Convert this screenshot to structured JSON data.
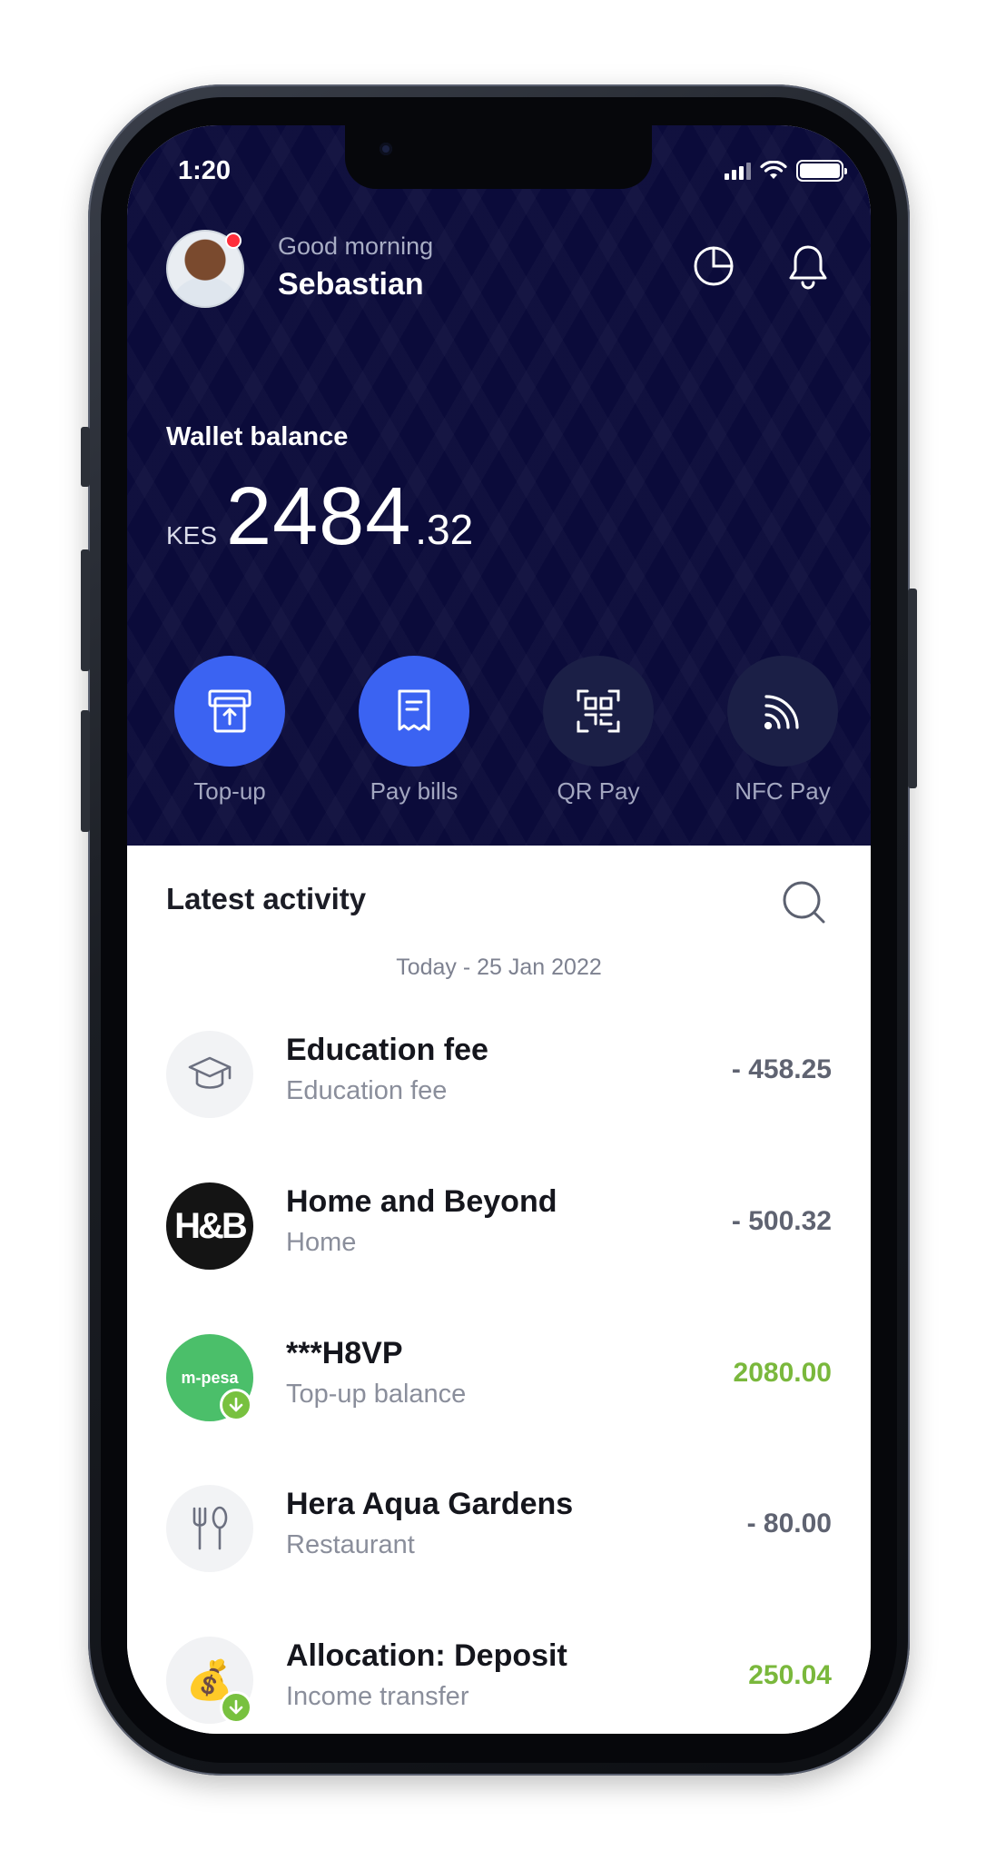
{
  "status": {
    "time": "1:20"
  },
  "user": {
    "greeting": "Good morning",
    "name": "Sebastian"
  },
  "wallet": {
    "label": "Wallet balance",
    "currency": "KES",
    "whole": "2484",
    "decimal": ".32"
  },
  "actions": [
    {
      "label": "Top-up",
      "icon": "top-up-icon"
    },
    {
      "label": "Pay bills",
      "icon": "receipt-icon"
    },
    {
      "label": "QR Pay",
      "icon": "qr-scan-icon"
    },
    {
      "label": "NFC Pay",
      "icon": "nfc-icon"
    }
  ],
  "activity": {
    "title": "Latest activity",
    "date": "Today - 25 Jan 2022",
    "transactions": [
      {
        "name": "Education fee",
        "sub": "Education fee",
        "amount": "- 458.25",
        "icon": "graduation-cap-icon"
      },
      {
        "name": "Home and Beyond",
        "sub": "Home",
        "amount": "- 500.32",
        "logo": "H&B"
      },
      {
        "name": "***H8VP",
        "sub": "Top-up balance",
        "amount": "2080.00",
        "logo": "m-pesa"
      },
      {
        "name": "Hera Aqua Gardens",
        "sub": "Restaurant",
        "amount": "- 80.00",
        "icon": "fork-knife-icon"
      },
      {
        "name": "Allocation: Deposit",
        "sub": "Income transfer",
        "amount": "250.04",
        "icon": "money-bag-icon"
      }
    ]
  },
  "colors": {
    "header": "#0b0b3a",
    "accent": "#3b63f2",
    "positive": "#7ab83c"
  }
}
